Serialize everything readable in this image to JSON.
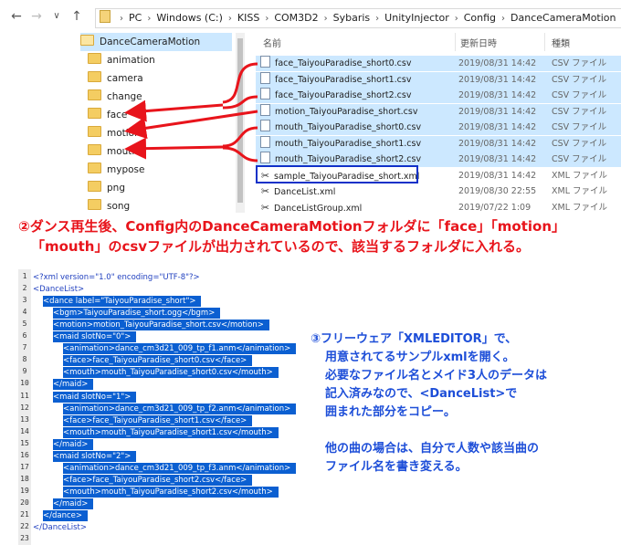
{
  "nav": {
    "back_icon": "back-arrow-icon",
    "forward_icon": "forward-arrow-icon",
    "recent_icon": "chevron-down-icon",
    "up_icon": "up-arrow-icon"
  },
  "breadcrumb": [
    "PC",
    "Windows (C:)",
    "KISS",
    "COM3D2",
    "Sybaris",
    "UnityInjector",
    "Config",
    "DanceCameraMotion"
  ],
  "tree": {
    "root": "DanceCameraMotion",
    "folders": [
      "animation",
      "camera",
      "change",
      "face",
      "motion",
      "mouth",
      "mypose",
      "png",
      "song"
    ]
  },
  "file_list": {
    "headers": {
      "name": "名前",
      "date": "更新日時",
      "type": "種類"
    },
    "rows": [
      {
        "name": "face_TaiyouParadise_short0.csv",
        "date": "2019/08/31 14:42",
        "type": "CSV ファイル"
      },
      {
        "name": "face_TaiyouParadise_short1.csv",
        "date": "2019/08/31 14:42",
        "type": "CSV ファイル"
      },
      {
        "name": "face_TaiyouParadise_short2.csv",
        "date": "2019/08/31 14:42",
        "type": "CSV ファイル"
      },
      {
        "name": "motion_TaiyouParadise_short.csv",
        "date": "2019/08/31 14:42",
        "type": "CSV ファイル"
      },
      {
        "name": "mouth_TaiyouParadise_short0.csv",
        "date": "2019/08/31 14:42",
        "type": "CSV ファイル"
      },
      {
        "name": "mouth_TaiyouParadise_short1.csv",
        "date": "2019/08/31 14:42",
        "type": "CSV ファイル"
      },
      {
        "name": "mouth_TaiyouParadise_short2.csv",
        "date": "2019/08/31 14:42",
        "type": "CSV ファイル"
      },
      {
        "name": "sample_TaiyouParadise_short.xml",
        "date": "2019/08/31 14:42",
        "type": "XML ファイル"
      },
      {
        "name": "DanceList.xml",
        "date": "2019/08/30 22:55",
        "type": "XML ファイル"
      },
      {
        "name": "DanceListGroup.xml",
        "date": "2019/07/22 1:09",
        "type": "XML ファイル"
      }
    ]
  },
  "annotation2": {
    "line1": "②ダンス再生後、Config内のDanceCameraMotionフォルダに「face」「motion」",
    "line2": "「mouth」のcsvファイルが出力されているので、該当するフォルダに入れる。"
  },
  "editor": {
    "lines": [
      "<?xml version=\"1.0\" encoding=\"UTF-8\"?>",
      "<DanceList>",
      "<dance label=\"TaiyouParadise_short\">",
      "<bgm>TaiyouParadise_short.ogg</bgm>",
      "<motion>motion_TaiyouParadise_short.csv</motion>",
      "<maid slotNo=\"0\">",
      "<animation>dance_cm3d21_009_tp_f1.anm</animation>",
      "<face>face_TaiyouParadise_short0.csv</face>",
      "<mouth>mouth_TaiyouParadise_short0.csv</mouth>",
      "</maid>",
      "<maid slotNo=\"1\">",
      "<animation>dance_cm3d21_009_tp_f2.anm</animation>",
      "<face>face_TaiyouParadise_short1.csv</face>",
      "<mouth>mouth_TaiyouParadise_short1.csv</mouth>",
      "</maid>",
      "<maid slotNo=\"2\">",
      "<animation>dance_cm3d21_009_tp_f3.anm</animation>",
      "<face>face_TaiyouParadise_short2.csv</face>",
      "<mouth>mouth_TaiyouParadise_short2.csv</mouth>",
      "</maid>",
      "</dance>",
      "</DanceList>",
      ""
    ],
    "line_numbers": [
      "1",
      "2",
      "3",
      "4",
      "5",
      "6",
      "7",
      "8",
      "9",
      "10",
      "11",
      "12",
      "13",
      "14",
      "15",
      "16",
      "17",
      "18",
      "19",
      "20",
      "21",
      "22",
      "23"
    ]
  },
  "annotation3": {
    "lines": [
      "③フリーウェア「XMLEDITOR」で、",
      "用意されてるサンプルxmlを開く。",
      "必要なファイル名とメイド3人のデータは",
      "記入済みなので、<DanceList>で",
      "囲まれた部分をコピー。",
      "",
      "他の曲の場合は、自分で人数や該当曲の",
      "ファイル名を書き変える。"
    ]
  },
  "colors": {
    "annotation_red": "#e8141b",
    "annotation_blue": "#1d4ed8",
    "selection": "#cce8ff",
    "editor_selection": "#0b5fd1"
  }
}
